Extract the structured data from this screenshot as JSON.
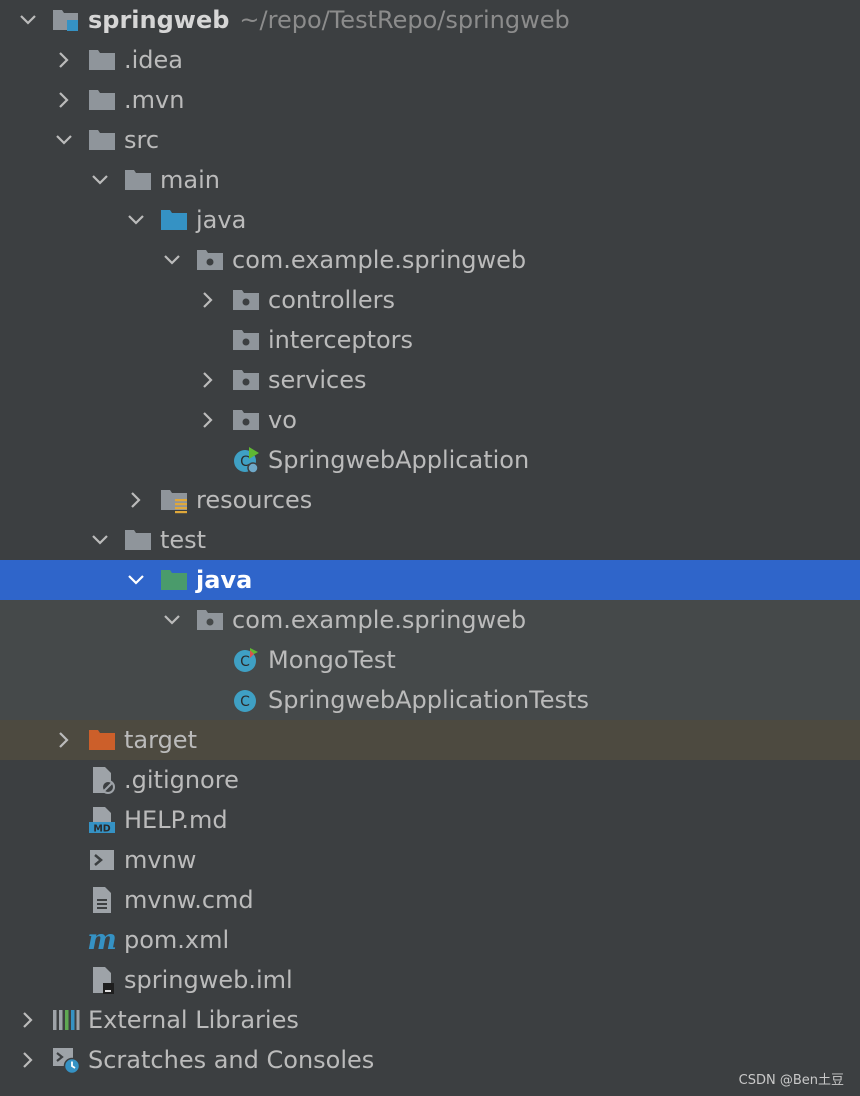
{
  "project": {
    "name": "springweb",
    "path": "~/repo/TestRepo/springweb"
  },
  "items": {
    "idea": ".idea",
    "mvn": ".mvn",
    "src": "src",
    "main": "main",
    "java_main": "java",
    "pkg_main": "com.example.springweb",
    "controllers": "controllers",
    "interceptors": "interceptors",
    "services": "services",
    "vo": "vo",
    "app": "SpringwebApplication",
    "resources": "resources",
    "test": "test",
    "java_test": "java",
    "pkg_test": "com.example.springweb",
    "mongotest": "MongoTest",
    "apptests": "SpringwebApplicationTests",
    "target": "target",
    "gitignore": ".gitignore",
    "help": "HELP.md",
    "mvnw": "mvnw",
    "mvnwcmd": "mvnw.cmd",
    "pom": "pom.xml",
    "iml": "springweb.iml",
    "extlibs": "External Libraries",
    "scratches": "Scratches and Consoles"
  },
  "icon_labels": {
    "markdown": "MD",
    "class": "C",
    "maven": "m"
  },
  "watermark": "CSDN @Ben土豆",
  "colors": {
    "folder": "#8f959b",
    "source_folder": "#3592c4",
    "test_folder": "#4a9b6b",
    "excluded_folder": "#cc5f2a",
    "selection": "#2f65ca",
    "class_icon": "#3fa0c4"
  }
}
